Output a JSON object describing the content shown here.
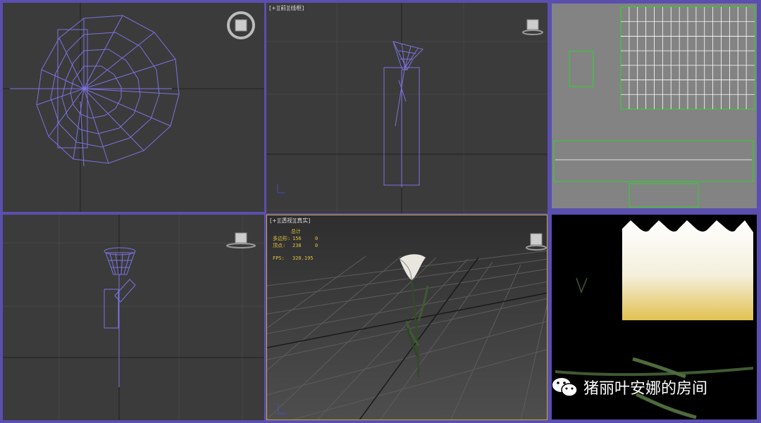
{
  "viewports": {
    "front": {
      "label": "[+][前][线框]"
    },
    "perspective": {
      "label": "[+][透视][真实]",
      "stats": {
        "header": "总计",
        "polygons_label": "多边形:",
        "polygons_value": "156",
        "polygons_sel": "0",
        "vertices_label": "顶点:",
        "vertices_value": "238",
        "vertices_sel": "0",
        "fps_label": "FPS:",
        "fps_value": "320.195"
      }
    }
  },
  "watermark": {
    "text": "猪丽叶安娜的房间",
    "icon": "wechat-icon"
  },
  "colors": {
    "wire": "#7b72e0",
    "uv_green": "#2bd62b",
    "frame": "#5a4fae"
  }
}
